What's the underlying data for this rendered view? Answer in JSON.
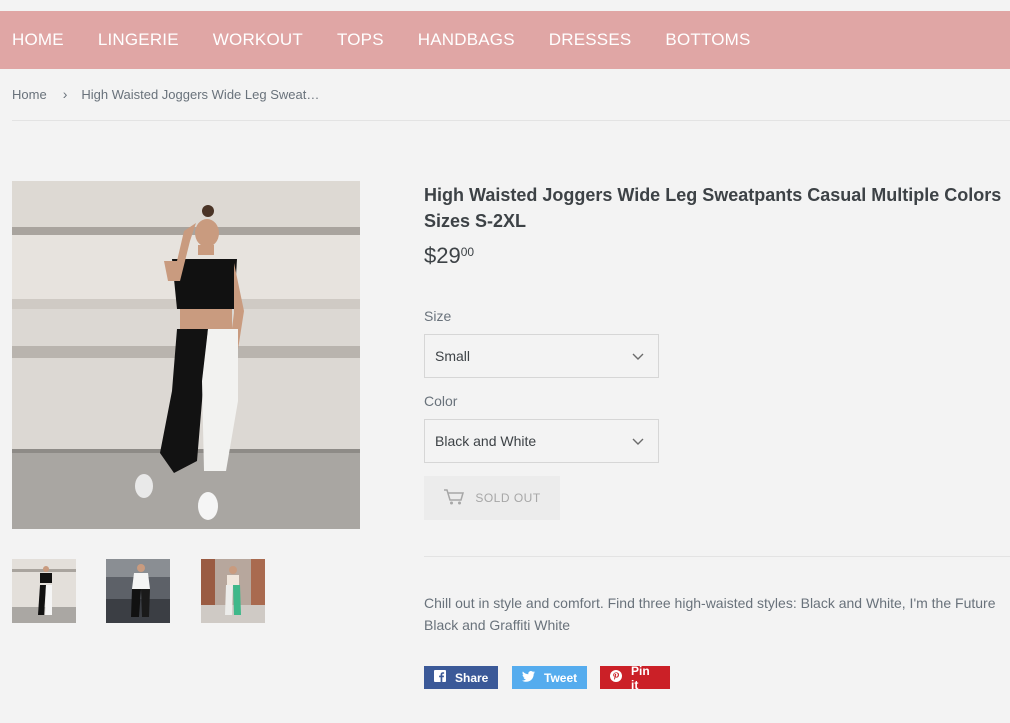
{
  "nav": {
    "items": [
      "HOME",
      "LINGERIE",
      "WORKOUT",
      "TOPS",
      "HANDBAGS",
      "DRESSES",
      "BOTTOMS"
    ]
  },
  "breadcrumb": {
    "home": "Home",
    "separator": "›",
    "current": "High Waisted Joggers Wide Leg Sweat…"
  },
  "product": {
    "title": "High Waisted Joggers Wide Leg Sweatpants Casual Multiple Colors Sizes S-2XL",
    "price_main": "$29",
    "price_cents": "00",
    "size_label": "Size",
    "size_value": "Small",
    "color_label": "Color",
    "color_value": "Black and White",
    "soldout_label": "SOLD OUT",
    "description": "Chill out in style and comfort. Find three high-waisted styles: Black and White, I'm the Future Black and Graffiti White"
  },
  "share": {
    "facebook_label": "Share",
    "twitter_label": "Tweet",
    "pinterest_label": "Pin it"
  },
  "colors": {
    "nav_bg": "#e0a6a5",
    "page_bg": "#f3f3f3",
    "facebook": "#3b5998",
    "twitter": "#55acee",
    "pinterest": "#cb2027"
  },
  "icons": [
    "chevron-down-icon",
    "cart-icon",
    "facebook-icon",
    "twitter-icon",
    "pinterest-icon"
  ]
}
